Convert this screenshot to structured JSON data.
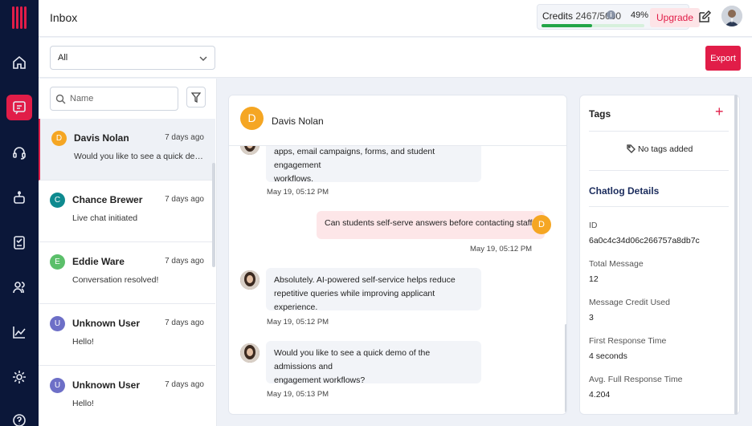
{
  "header": {
    "title": "Inbox"
  },
  "credits": {
    "label": "Credits",
    "count": "2467/5000",
    "percent_label": "49%",
    "fraction_used": 0.49,
    "upgrade_label": "Upgrade"
  },
  "filter": {
    "selected": "All",
    "export_label": "Export"
  },
  "search": {
    "placeholder": "Name"
  },
  "conversations": [
    {
      "initial": "D",
      "name": "Davis Nolan",
      "time": "7 days ago",
      "preview": "Would you like to see a quick demo of the admissions and engagement workflows?",
      "color": "#f5a623"
    },
    {
      "initial": "C",
      "name": "Chance Brewer",
      "time": "7 days ago",
      "preview": "Live chat initiated",
      "color": "#0e8a8f"
    },
    {
      "initial": "E",
      "name": "Eddie Ware",
      "time": "7 days ago",
      "preview": "Conversation resolved!",
      "color": "#5bbf6a"
    },
    {
      "initial": "U",
      "name": "Unknown User",
      "time": "7 days ago",
      "preview": "Hello!",
      "color": "#6d6fc7"
    },
    {
      "initial": "U",
      "name": "Unknown User",
      "time": "7 days ago",
      "preview": "Hello!",
      "color": "#6d6fc7"
    }
  ],
  "chat": {
    "initial": "D",
    "name": "Davis Nolan",
    "messages": [
      {
        "role": "bot",
        "line1": "apps, email campaigns, forms, and student engagement",
        "line2": "workflows.",
        "time": "May 19, 05:12 PM"
      },
      {
        "role": "user",
        "text": "Can students self-serve answers before contacting staff?",
        "initial": "D",
        "time": "May 19, 05:12 PM"
      },
      {
        "role": "bot",
        "line1": "Absolutely. AI-powered self-service helps reduce",
        "line2": "repetitive queries while improving applicant experience.",
        "time": "May 19, 05:12 PM"
      },
      {
        "role": "bot",
        "line1": "Would you like to see a quick demo of the admissions and",
        "line2": "engagement workflows?",
        "time": "May 19, 05:13 PM"
      }
    ]
  },
  "tags": {
    "title": "Tags",
    "add_label": "+",
    "empty": "No tags added"
  },
  "details": {
    "title": "Chatlog Details",
    "fields": [
      {
        "label": "ID",
        "value": "6a0c4c34d06c266757a8db7c"
      },
      {
        "label": "Total Message",
        "value": "12"
      },
      {
        "label": "Message Credit Used",
        "value": "3"
      },
      {
        "label": "First Response Time",
        "value": "4 seconds"
      },
      {
        "label": "Avg. Full Response Time",
        "value": "4.204"
      }
    ]
  },
  "colors": {
    "accent": "#e11d48",
    "sidebar": "#0b1739",
    "credit_bar": "#22a548"
  }
}
